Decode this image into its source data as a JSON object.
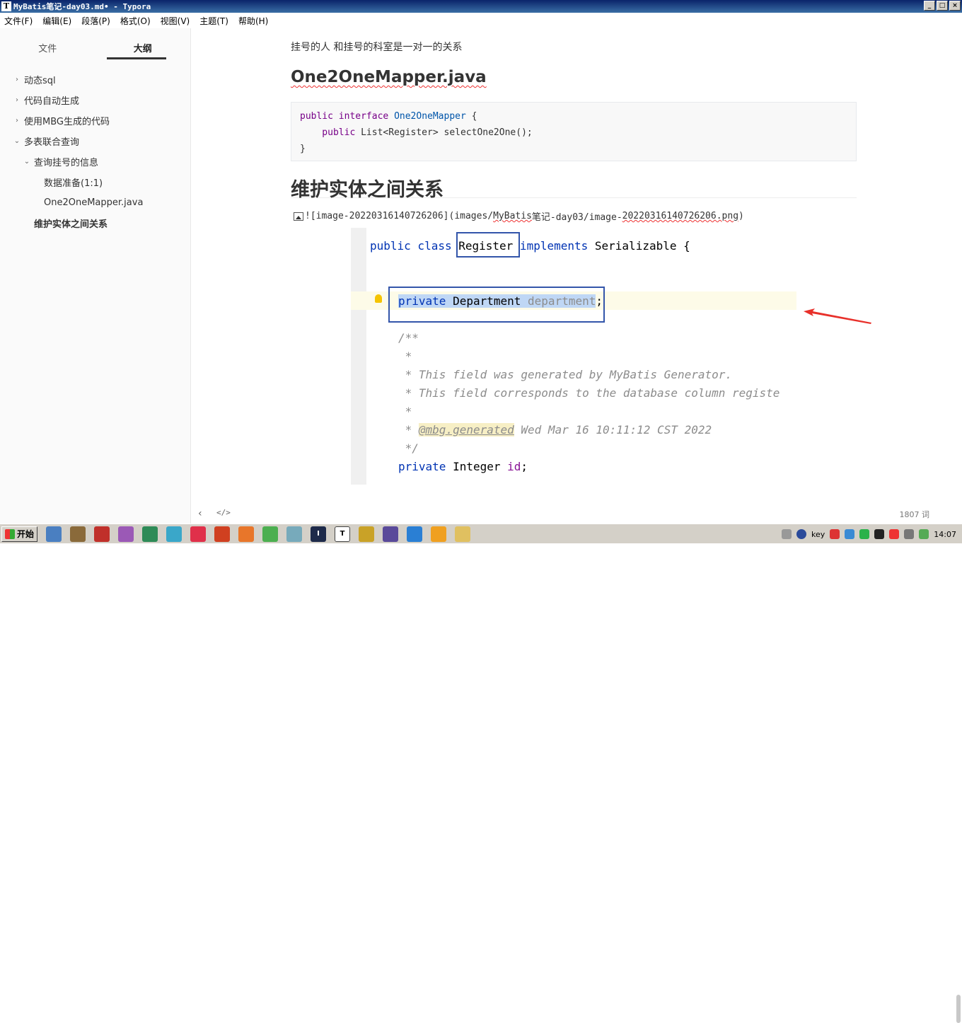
{
  "window": {
    "title": "MyBatis笔记-day03.md• - Typora",
    "app_glyph": "T",
    "controls": [
      "_",
      "□",
      "×"
    ]
  },
  "menu": [
    "文件(F)",
    "编辑(E)",
    "段落(P)",
    "格式(O)",
    "视图(V)",
    "主题(T)",
    "帮助(H)"
  ],
  "sidebar": {
    "tabs": [
      "文件",
      "大纲"
    ],
    "outline": [
      {
        "label": "动态sql",
        "caret": "›"
      },
      {
        "label": "代码自动生成",
        "caret": "›"
      },
      {
        "label": "使用MBG生成的代码",
        "caret": "›"
      },
      {
        "label": "多表联合查询",
        "caret": "⌄"
      },
      {
        "label": "查询挂号的信息",
        "caret": "⌄"
      },
      {
        "label": "数据准备(1:1)",
        "caret": ""
      },
      {
        "label": "One2OneMapper.java",
        "caret": ""
      },
      {
        "label": "维护实体之间关系",
        "caret": ""
      }
    ]
  },
  "doc": {
    "p1": "挂号的人 和挂号的科室是一对一的关系",
    "h2": "One2OneMapper.java",
    "code": {
      "l1_kw": "public interface ",
      "l1_name": "One2OneMapper",
      "l1_end": " {",
      "l2_kw": "    public ",
      "l2_rest": "List<Register> selectOne2One();",
      "l3": "}"
    },
    "h1": "维护实体之间关系",
    "image_line": {
      "p1": "![image-20220316140726206](images/",
      "p2": "MyBatis",
      "p3": "笔记-day03/image-",
      "p4": "20220316140726206.png",
      "p5": ")"
    },
    "ide": {
      "l1a": "public class ",
      "l1b": "Register",
      "l1c": " implements ",
      "l1d": "Serializable {",
      "l2a": "private ",
      "l2b": "Department ",
      "l2c": "department",
      "l2d": ";",
      "c1": "/**",
      "c2": " *",
      "c3": " * This field was generated by MyBatis Generator.",
      "c4": " * This field corresponds to the database column registe",
      "c5": " *",
      "c6a": " * ",
      "c6b": "@mbg.generated",
      "c6c": " Wed Mar 16 10:11:12 CST 2022",
      "c7": " */",
      "l3a": "private ",
      "l3b": "Integer ",
      "l3c": "id",
      ";": ";"
    }
  },
  "status": {
    "left": "‹",
    "source": "</>",
    "wordcount": "1807 词"
  },
  "taskbar": {
    "start": "开始",
    "apps": [
      "",
      "",
      "",
      "",
      "",
      "",
      "",
      "",
      "",
      "",
      "",
      "",
      "I",
      "T",
      "",
      "",
      "",
      "",
      ""
    ],
    "tray_text": "key",
    "clock": "14:07"
  }
}
